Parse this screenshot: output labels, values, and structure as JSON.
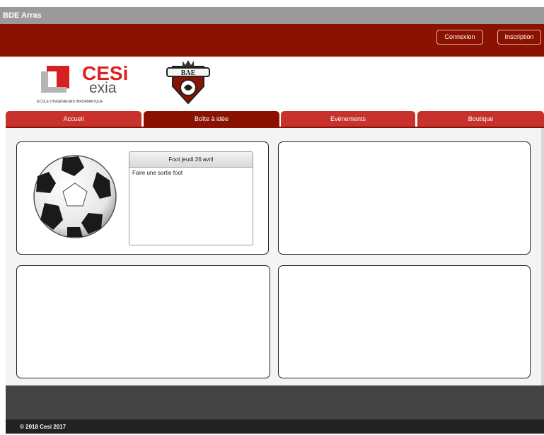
{
  "window": {
    "title": "BDE Arras"
  },
  "header": {
    "login_label": "Connexion",
    "signup_label": "Inscription"
  },
  "logos": {
    "cesi_main": "CESi",
    "cesi_sub": "exia",
    "cesi_tagline": "ÉCOLE D'INGÉNIEURS INFORMATIQUE",
    "bde_text": "BAE"
  },
  "nav": {
    "tabs": [
      {
        "label": "Accueil",
        "active": false
      },
      {
        "label": "Boîte à idée",
        "active": true
      },
      {
        "label": "Evénements",
        "active": false
      },
      {
        "label": "Boutique",
        "active": false
      }
    ]
  },
  "ideas": [
    {
      "title": "Foot jeudi 26 avril",
      "description": "Faire une sortie foot",
      "image_icon": "soccer-ball-icon"
    }
  ],
  "footer": {
    "copyright": "© 2018 Cesi 2017"
  },
  "colors": {
    "primary_dark": "#8b1200",
    "primary": "#c8312c",
    "titlebar": "#9a9a9a",
    "footer_band": "#444444"
  }
}
